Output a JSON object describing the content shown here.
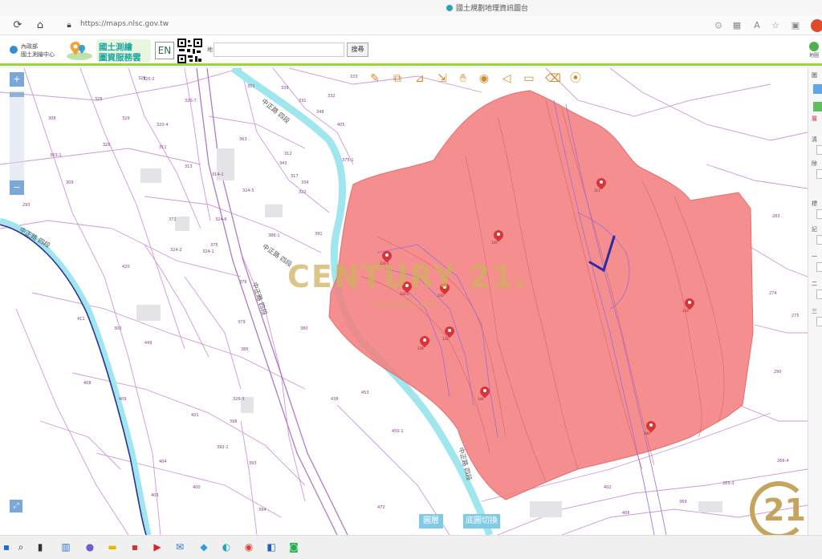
{
  "window": {
    "title": "國土規劃地理資訊圖台"
  },
  "browser": {
    "url": "https://maps.nlsc.gov.tw"
  },
  "header": {
    "org_line1": "內政部",
    "org_line2": "國土測繪中心",
    "site_title_1": "國土測繪",
    "site_title_2": "圖資服務雲",
    "lang_button": "EN",
    "search_label": "地",
    "search_placeholder": "",
    "search_button": "搜尋",
    "globe_label": "地圖"
  },
  "toolbar": {
    "tools": [
      "edit-icon",
      "layers-icon",
      "measure-icon",
      "export-icon",
      "hand-icon",
      "eye-icon",
      "triangle-icon",
      "screen-icon",
      "eraser-icon",
      "location-icon"
    ]
  },
  "map": {
    "zoom_in": "+",
    "zoom_out": "−",
    "watermark": "CENTURY 21.",
    "watermark_sub": "台灣房屋仲介股份",
    "road_labels": [
      "中正路 四段",
      "中正路 四段",
      "中正路 四段",
      "中正路 四段",
      "中正路 四段"
    ],
    "lot_labels": [
      "320-2",
      "325",
      "320-7",
      "326",
      "328",
      "329",
      "320-4",
      "351",
      "339",
      "331",
      "332",
      "333",
      "334",
      "343",
      "363",
      "363-1",
      "372",
      "375",
      "376",
      "379",
      "380",
      "385",
      "326-3",
      "398",
      "392-1",
      "393",
      "394",
      "400",
      "403",
      "404",
      "409",
      "408",
      "411",
      "420",
      "449",
      "431",
      "438",
      "453",
      "450-1",
      "472",
      "402",
      "406",
      "369",
      "265-3",
      "266-4",
      "274",
      "275",
      "283",
      "290",
      "293",
      "300",
      "308",
      "309",
      "311",
      "313",
      "314-1",
      "324-1",
      "324-6",
      "324-5",
      "324-2",
      "312",
      "317",
      "322",
      "348",
      "405",
      "375-1",
      "386-1",
      "391"
    ],
    "pins": [
      "311",
      "320",
      "326-1",
      "326-2",
      "330",
      "333",
      "335",
      "339",
      "344",
      "349"
    ]
  },
  "bottom_buttons": {
    "left": "圖層",
    "right": "底圖切換"
  },
  "side_panel": {
    "labels": [
      "圖",
      "層",
      "清",
      "除",
      "標",
      "記",
      "一",
      "二",
      "三"
    ]
  },
  "taskbar": {
    "icons": [
      "windows-icon",
      "search-icon",
      "task-view-icon",
      "widgets-icon",
      "chat-icon",
      "file-explorer-icon",
      "store-icon",
      "youtube-icon",
      "mail-icon",
      "photos-icon",
      "edge-icon",
      "chrome-icon",
      "outlook-icon",
      "line-icon"
    ]
  },
  "brand_logo": "21",
  "colors": {
    "parcel_fill": "#f47f7f",
    "river": "#9fe6ef",
    "lot_lines": "#c98ad6",
    "accent_green": "#9cd43a"
  }
}
